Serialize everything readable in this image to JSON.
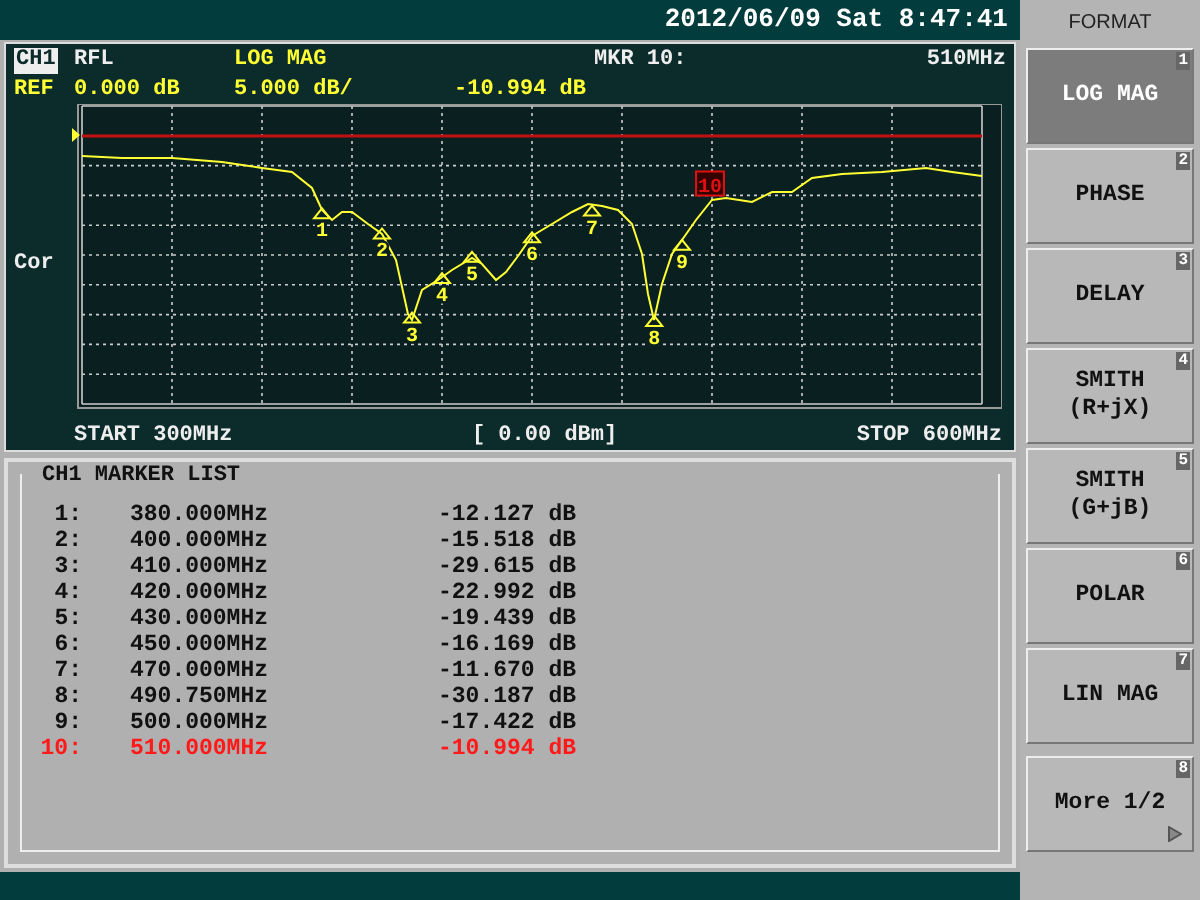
{
  "status_bar": {
    "datetime": "2012/06/09 Sat  8:47:41"
  },
  "display": {
    "channel": "CH1",
    "measurement": "RFL",
    "format": "LOG MAG",
    "marker_readout": "MKR 10:",
    "marker_freq": "510MHz",
    "ref_label": "REF",
    "ref_value": "0.000 dB",
    "scale": "5.000 dB/",
    "marker_value": "-10.994 dB",
    "side_label": "Cor",
    "start": "START 300MHz",
    "power": "[ 0.00 dBm]",
    "stop": "STOP 600MHz",
    "plot_markers": [
      {
        "label": "1",
        "selected": false
      },
      {
        "label": "2",
        "selected": false
      },
      {
        "label": "3",
        "selected": false
      },
      {
        "label": "4",
        "selected": false
      },
      {
        "label": "5",
        "selected": false
      },
      {
        "label": "6",
        "selected": false
      },
      {
        "label": "7",
        "selected": false
      },
      {
        "label": "8",
        "selected": false
      },
      {
        "label": "9",
        "selected": false
      },
      {
        "label": "10",
        "selected": true
      }
    ]
  },
  "marker_list": {
    "title": "CH1 MARKER LIST",
    "rows": [
      {
        "number": "1:",
        "frequency": "380.000MHz",
        "value": "-12.127 dB",
        "selected": false
      },
      {
        "number": "2:",
        "frequency": "400.000MHz",
        "value": "-15.518 dB",
        "selected": false
      },
      {
        "number": "3:",
        "frequency": "410.000MHz",
        "value": "-29.615 dB",
        "selected": false
      },
      {
        "number": "4:",
        "frequency": "420.000MHz",
        "value": "-22.992 dB",
        "selected": false
      },
      {
        "number": "5:",
        "frequency": "430.000MHz",
        "value": "-19.439 dB",
        "selected": false
      },
      {
        "number": "6:",
        "frequency": "450.000MHz",
        "value": "-16.169 dB",
        "selected": false
      },
      {
        "number": "7:",
        "frequency": "470.000MHz",
        "value": "-11.670 dB",
        "selected": false
      },
      {
        "number": "8:",
        "frequency": "490.750MHz",
        "value": "-30.187 dB",
        "selected": false
      },
      {
        "number": "9:",
        "frequency": "500.000MHz",
        "value": "-17.422 dB",
        "selected": false
      },
      {
        "number": "10:",
        "frequency": "510.000MHz",
        "value": "-10.994 dB",
        "selected": true
      }
    ]
  },
  "softkeys": {
    "title": "FORMAT",
    "items": [
      {
        "label": "LOG MAG",
        "number": "1",
        "selected": true
      },
      {
        "label": "PHASE",
        "number": "2",
        "selected": false
      },
      {
        "label": "DELAY",
        "number": "3",
        "selected": false
      },
      {
        "label": "SMITH\n(R+jX)",
        "number": "4",
        "selected": false
      },
      {
        "label": "SMITH\n(G+jB)",
        "number": "5",
        "selected": false
      },
      {
        "label": "POLAR",
        "number": "6",
        "selected": false
      },
      {
        "label": "LIN MAG",
        "number": "7",
        "selected": false
      },
      {
        "label": "More 1/2",
        "number": "8",
        "selected": false,
        "submenu": true
      }
    ]
  }
}
